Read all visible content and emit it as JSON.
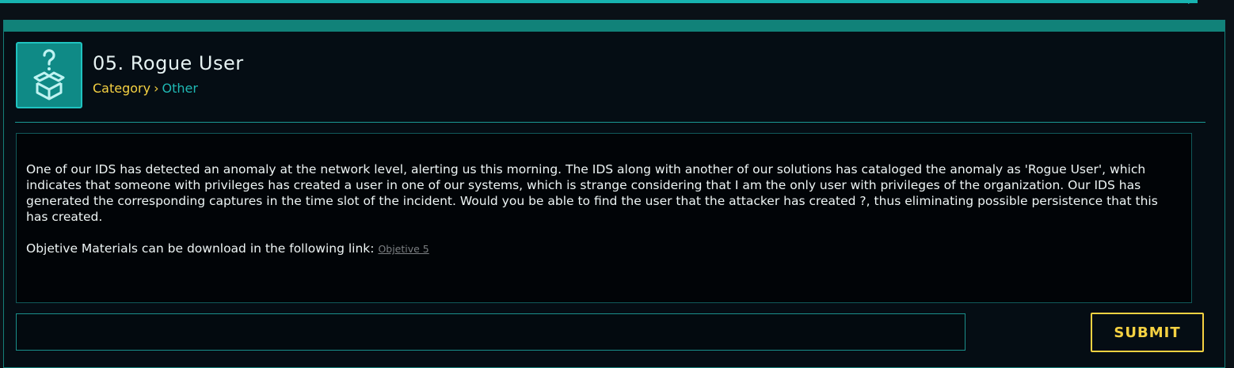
{
  "challenge": {
    "title": "05. Rogue User",
    "icon": "question-box-icon",
    "category_label": "Category",
    "separator": "›",
    "category_value": "Other"
  },
  "description": {
    "text": "One of our IDS has detected an anomaly at the network level, alerting us this morning. The IDS along with another of our solutions has cataloged the anomaly as 'Rogue User', which indicates that someone with privileges has created a user in one of our systems, which is strange considering that I am the only user with privileges of the organization. Our IDS has generated the corresponding captures in the time slot of the incident. Would you be able to find the user that the attacker has created ?, thus eliminating possible persistence that this has created.",
    "materials_text": "Objetive Materials can be download in the following link:",
    "materials_link": "Objetive 5"
  },
  "flag_form": {
    "input_value": "",
    "input_placeholder": "",
    "submit_label": "SUBMIT"
  },
  "colors": {
    "accent_teal": "#17b3b0",
    "accent_yellow": "#f5d142",
    "background": "#0a1117",
    "panel": "#050d14"
  }
}
